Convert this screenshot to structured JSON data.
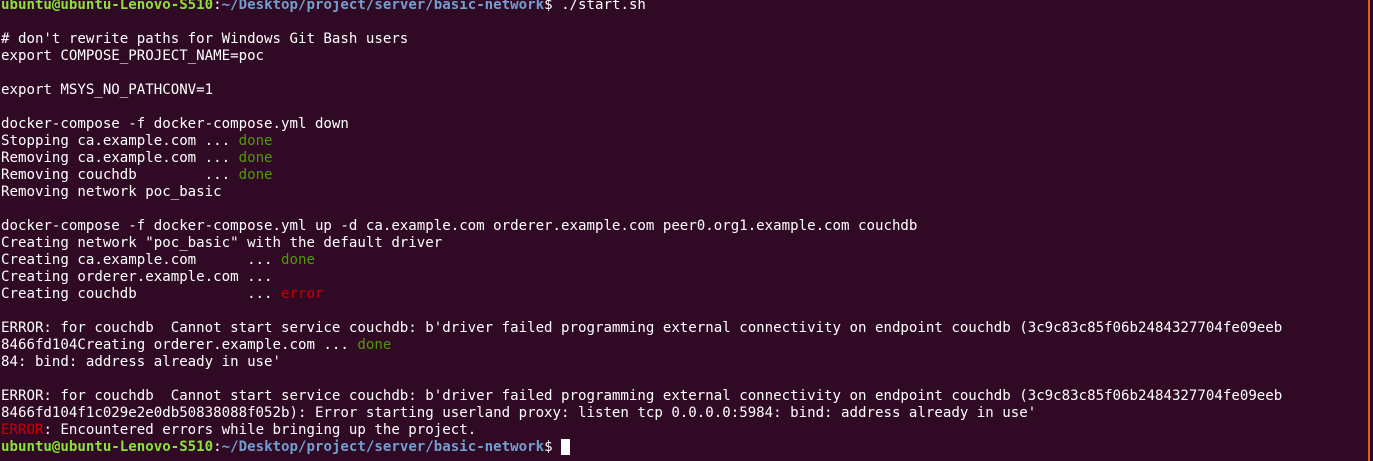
{
  "terminal": {
    "colors": {
      "background": "#300a24",
      "foreground": "#ffffff",
      "prompt_user": "#8ae234",
      "prompt_path": "#729fcf",
      "success": "#4e9a06",
      "error": "#cc0000"
    },
    "prompt": {
      "user_host": "ubuntu@ubuntu-Lenovo-S510",
      "separator": ":",
      "path": "~/Desktop/project/server/basic-network",
      "symbol": "$ "
    },
    "first_command": "./start.sh",
    "lines": {
      "l01": "# don't rewrite paths for Windows Git Bash users",
      "l02": "export COMPOSE_PROJECT_NAME=poc",
      "l04": "export MSYS_NO_PATHCONV=1",
      "l06": "docker-compose -f docker-compose.yml down",
      "l07a": "Stopping ca.example.com ... ",
      "l07b": "done",
      "l08a": "Removing ca.example.com ... ",
      "l08b": "done",
      "l09a": "Removing couchdb        ... ",
      "l09b": "done",
      "l10": "Removing network poc_basic",
      "l12": "docker-compose -f docker-compose.yml up -d ca.example.com orderer.example.com peer0.org1.example.com couchdb",
      "l13": "Creating network \"poc_basic\" with the default driver",
      "l14a": "Creating ca.example.com      ... ",
      "l14b": "done",
      "l15": "Creating orderer.example.com ...",
      "l16a": "Creating couchdb             ... ",
      "l16b": "error",
      "l18": "ERROR: for couchdb  Cannot start service couchdb: b'driver failed programming external connectivity on endpoint couchdb (3c9c83c85f06b2484327704fe09eeb",
      "l19a": "8466fd104Creating orderer.example.com ... ",
      "l19b": "done",
      "l20": "84: bind: address already in use'",
      "l22": "ERROR: for couchdb  Cannot start service couchdb: b'driver failed programming external connectivity on endpoint couchdb (3c9c83c85f06b2484327704fe09eeb",
      "l23": "8466fd104f1c029e2e0db50838088f052b): Error starting userland proxy: listen tcp 0.0.0.0:5984: bind: address already in use'",
      "l24a": "ERROR",
      "l24b": ": Encountered errors while bringing up the project."
    }
  }
}
